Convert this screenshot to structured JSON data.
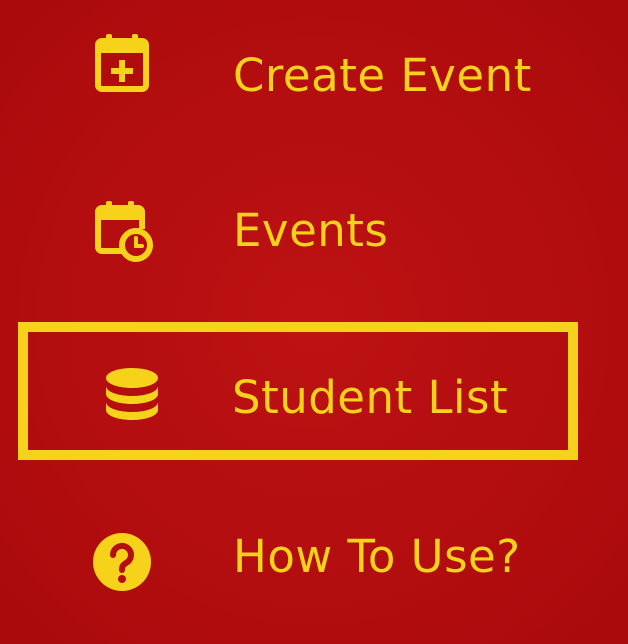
{
  "colors": {
    "background": "#b50d10",
    "accent": "#f6d21a"
  },
  "menu": {
    "items": [
      {
        "label": "Create Event",
        "icon": "calendar-plus-icon",
        "selected": false
      },
      {
        "label": "Events",
        "icon": "calendar-clock-icon",
        "selected": false
      },
      {
        "label": "Student List",
        "icon": "database-icon",
        "selected": true
      },
      {
        "label": "How To Use?",
        "icon": "question-circle-icon",
        "selected": false
      }
    ]
  }
}
